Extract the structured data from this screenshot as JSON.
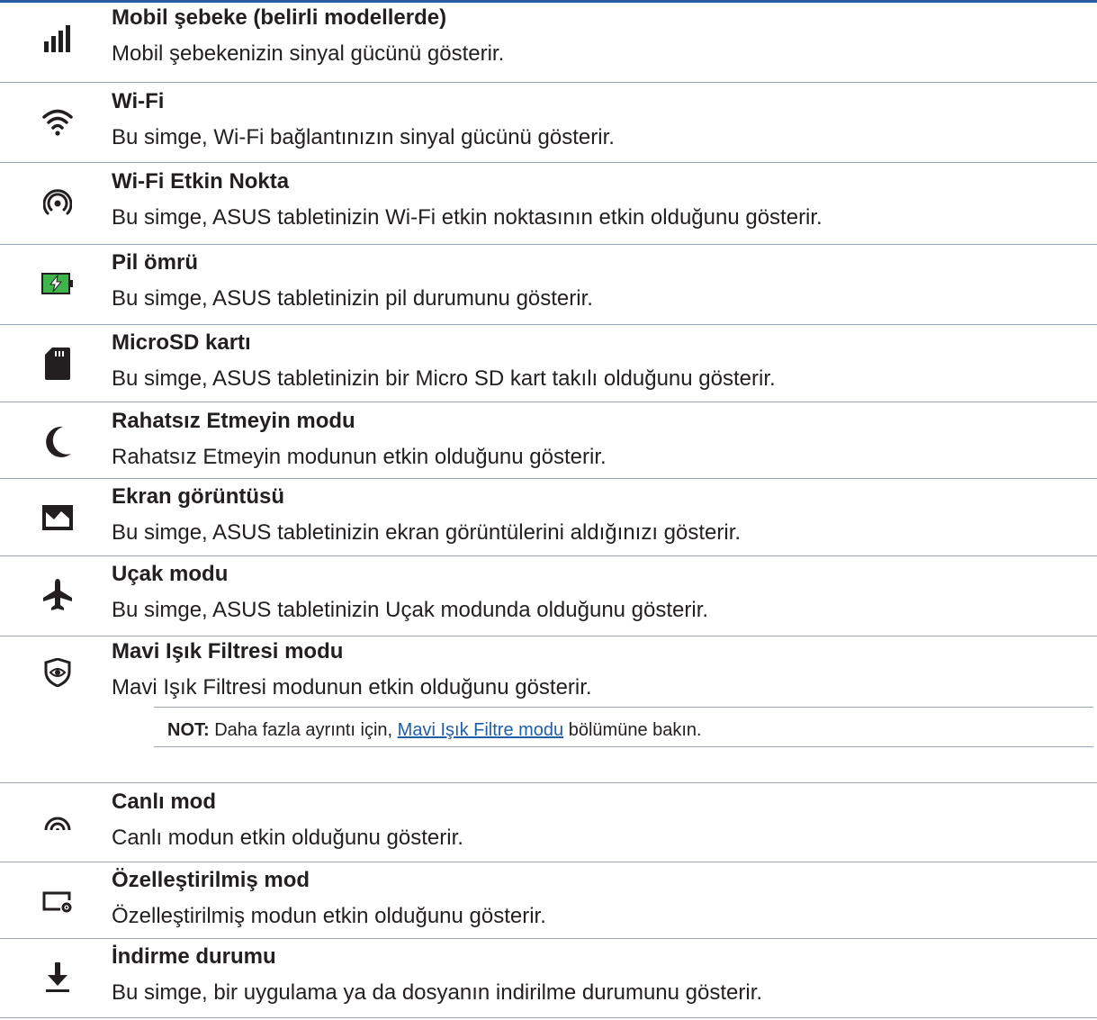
{
  "items": [
    {
      "icon": "signal-bars-icon",
      "title": "Mobil şebeke (belirli modellerde)",
      "desc": "Mobil şebekenizin sinyal gücünü gösterir."
    },
    {
      "icon": "wifi-icon",
      "title": "Wi-Fi",
      "desc": "Bu simge, Wi-Fi bağlantınızın sinyal gücünü gösterir."
    },
    {
      "icon": "hotspot-icon",
      "title": "Wi-Fi Etkin Nokta",
      "desc": "Bu simge, ASUS tabletinizin Wi-Fi etkin noktasının etkin olduğunu gösterir."
    },
    {
      "icon": "battery-charging-icon",
      "title": "Pil ömrü",
      "desc": "Bu simge, ASUS tabletinizin pil durumunu gösterir."
    },
    {
      "icon": "sd-card-icon",
      "title": "MicroSD kartı",
      "desc": "Bu simge, ASUS tabletinizin bir Micro SD kart takılı olduğunu gösterir."
    },
    {
      "icon": "moon-icon",
      "title": "Rahatsız Etmeyin modu",
      "desc": "Rahatsız Etmeyin modunun etkin olduğunu gösterir."
    },
    {
      "icon": "screenshot-icon",
      "title": "Ekran görüntüsü",
      "desc": "Bu simge, ASUS tabletinizin ekran görüntülerini aldığınızı gösterir."
    },
    {
      "icon": "airplane-icon",
      "title": "Uçak modu",
      "desc": "Bu simge, ASUS tabletinizin Uçak modunda olduğunu gösterir."
    },
    {
      "icon": "eye-shield-icon",
      "title": "Mavi Işık Filtresi modu",
      "desc": "Mavi Işık Filtresi modunun etkin olduğunu gösterir."
    },
    {
      "icon": "live-mode-icon",
      "title": "Canlı mod",
      "desc": "Canlı modun etkin olduğunu gösterir."
    },
    {
      "icon": "custom-mode-icon",
      "title": "Özelleştirilmiş mod",
      "desc": "Özelleştirilmiş modun etkin olduğunu gösterir."
    },
    {
      "icon": "download-icon",
      "title": "İndirme durumu",
      "desc": "Bu simge, bir uygulama ya da dosyanın indirilme durumunu gösterir."
    }
  ],
  "note": {
    "label": "NOT:",
    "before": "Daha fazla ayrıntı için,",
    "link": "Mavi Işık Filtre modu",
    "after": "bölümüne bakın."
  },
  "colors": {
    "rule": "#2a5aa0",
    "link": "#1f5fa6",
    "battery": "#3db54a"
  }
}
